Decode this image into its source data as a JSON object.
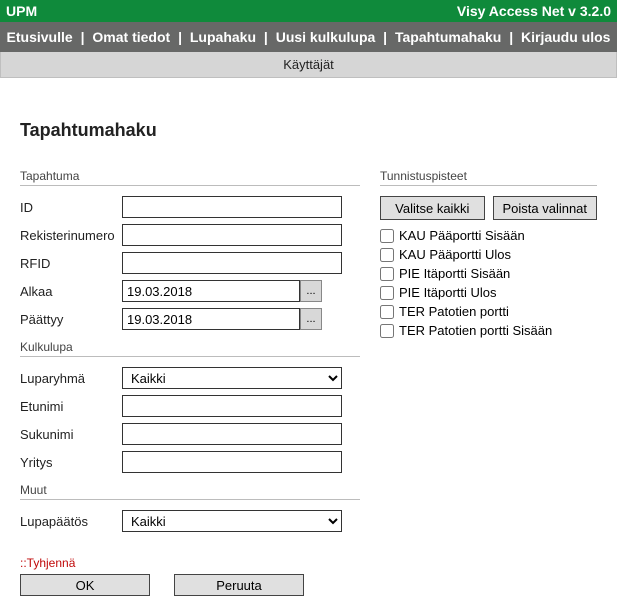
{
  "titlebar": {
    "app": "UPM",
    "version": "Visy Access Net v 3.2.0"
  },
  "nav": {
    "items": [
      "Etusivulle",
      "Omat tiedot",
      "Lupahaku",
      "Uusi kulkulupa",
      "Tapahtumahaku",
      "Kirjaudu ulos"
    ],
    "sep": "|"
  },
  "subbar": {
    "label": "Käyttäjät"
  },
  "page": {
    "title": "Tapahtumahaku"
  },
  "sections": {
    "tapahtuma": "Tapahtuma",
    "kulkulupa": "Kulkulupa",
    "muut": "Muut",
    "tunnistuspisteet": "Tunnistuspisteet"
  },
  "fields": {
    "id": {
      "label": "ID",
      "value": ""
    },
    "rekisterinumero": {
      "label": "Rekisterinumero",
      "value": ""
    },
    "rfid": {
      "label": "RFID",
      "value": ""
    },
    "alkaa": {
      "label": "Alkaa",
      "value": "19.03.2018"
    },
    "paattyy": {
      "label": "Päättyy",
      "value": "19.03.2018"
    },
    "luparyhma": {
      "label": "Luparyhmä",
      "value": "Kaikki"
    },
    "etunimi": {
      "label": "Etunimi",
      "value": ""
    },
    "sukunimi": {
      "label": "Sukunimi",
      "value": ""
    },
    "yritys": {
      "label": "Yritys",
      "value": ""
    },
    "lupapaatos": {
      "label": "Lupapäätös",
      "value": "Kaikki"
    }
  },
  "points": {
    "buttons": {
      "select_all": "Valitse kaikki",
      "clear_all": "Poista valinnat"
    },
    "items": [
      "KAU Pääportti Sisään",
      "KAU Pääportti Ulos",
      "PIE Itäportti Sisään",
      "PIE Itäportti Ulos",
      "TER Patotien portti",
      "TER Patotien portti Sisään"
    ]
  },
  "footer": {
    "clear": "::Tyhjennä",
    "ok": "OK",
    "cancel": "Peruuta"
  },
  "datepicker_btn": "..."
}
